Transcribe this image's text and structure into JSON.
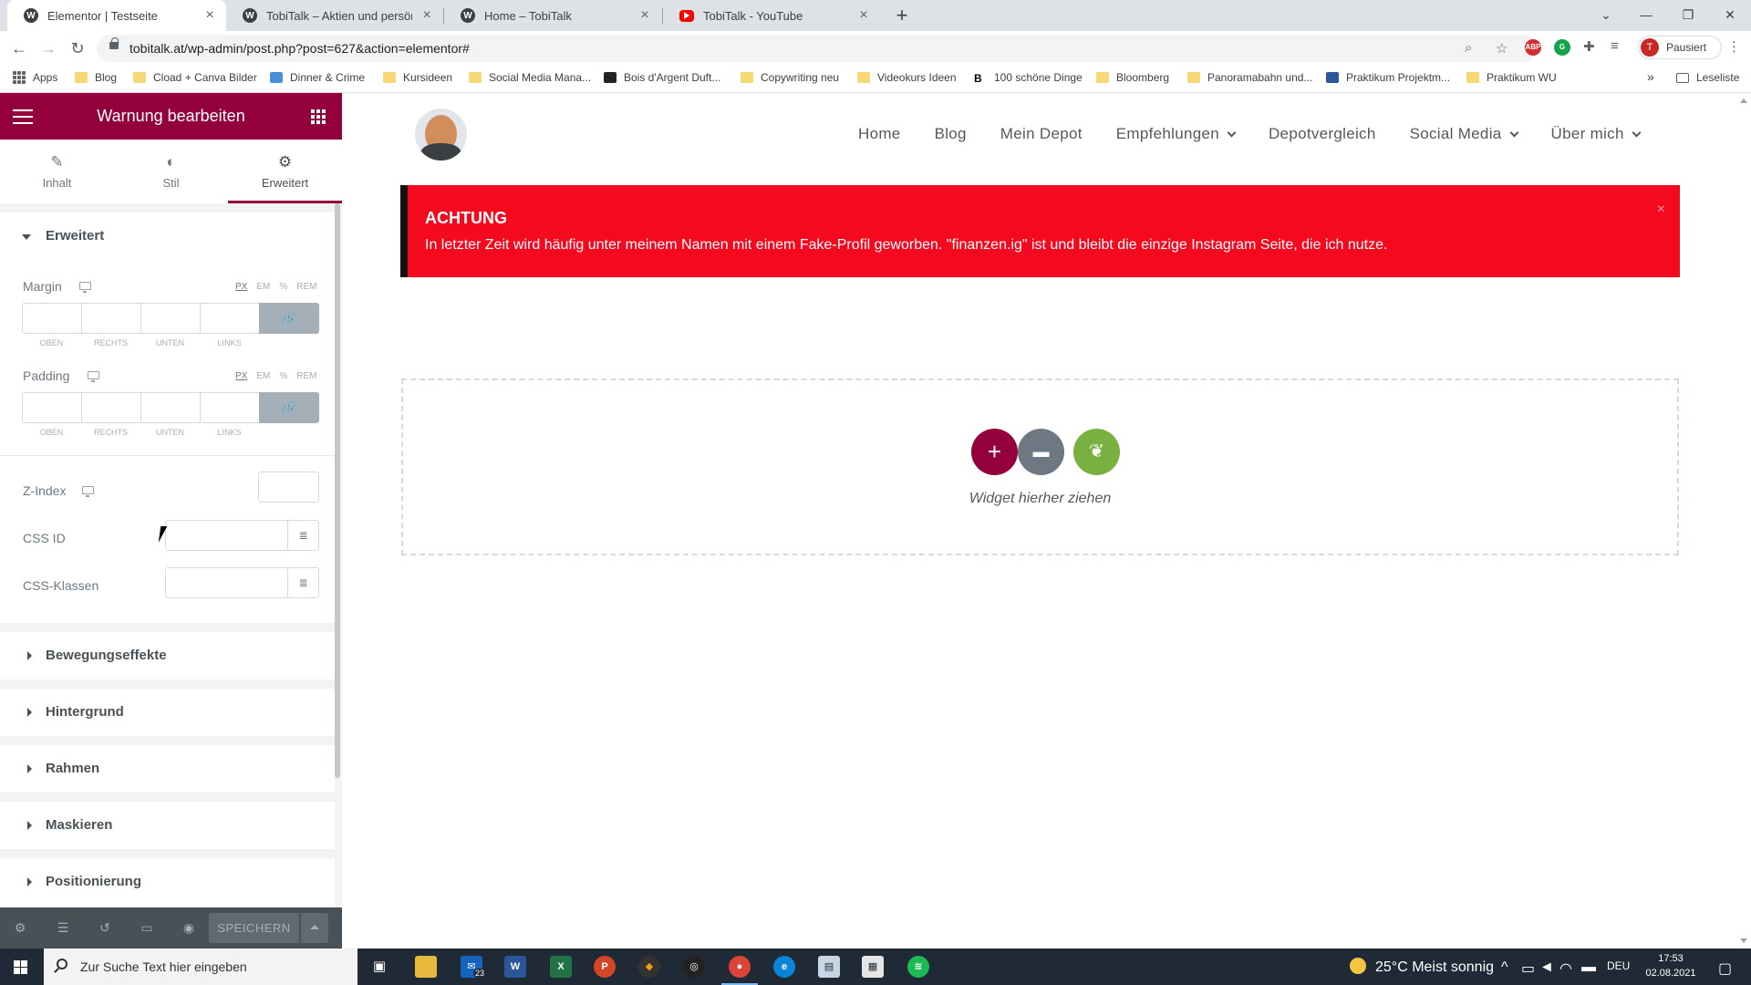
{
  "browser": {
    "tabs": [
      {
        "title": "Elementor | Testseite",
        "favicon": "wordpress-icon",
        "active": true
      },
      {
        "title": "TobiTalk – Aktien und persönliche",
        "favicon": "wordpress-icon",
        "active": false
      },
      {
        "title": "Home – TobiTalk",
        "favicon": "wordpress-icon",
        "active": false
      },
      {
        "title": "TobiTalk - YouTube",
        "favicon": "youtube-icon",
        "active": false
      }
    ],
    "new_tab": "+",
    "url": "tobitalk.at/wp-admin/post.php?post=627&action=elementor#",
    "profile_label": "Pausiert",
    "profile_initial": "T",
    "bookmarks": [
      {
        "label": "Apps",
        "icon": "apps-grid-icon"
      },
      {
        "label": "Blog",
        "icon": "folder-icon"
      },
      {
        "label": "Cload + Canva Bilder",
        "icon": "folder-icon"
      },
      {
        "label": "Dinner & Crime",
        "icon": "site-icon"
      },
      {
        "label": "Kursideen",
        "icon": "folder-icon"
      },
      {
        "label": "Social Media Mana...",
        "icon": "folder-icon"
      },
      {
        "label": "Bois d'Argent Duft...",
        "icon": "site-icon"
      },
      {
        "label": "Copywriting neu",
        "icon": "folder-icon"
      },
      {
        "label": "Videokurs Ideen",
        "icon": "folder-icon"
      },
      {
        "label": "100 schöne Dinge",
        "icon": "site-icon"
      },
      {
        "label": "Bloomberg",
        "icon": "folder-icon"
      },
      {
        "label": "Panoramabahn und...",
        "icon": "folder-icon"
      },
      {
        "label": "Praktikum Projektm...",
        "icon": "site-icon"
      },
      {
        "label": "Praktikum WU",
        "icon": "folder-icon"
      }
    ],
    "more_bookmarks": "»",
    "reading_list": "Leseliste"
  },
  "panel": {
    "header_title": "Warnung bearbeiten",
    "tabs": [
      {
        "label": "Inhalt",
        "icon": "pencil-icon"
      },
      {
        "label": "Stil",
        "icon": "contrast-icon"
      },
      {
        "label": "Erweitert",
        "icon": "gear-icon",
        "active": true
      }
    ],
    "section_title": "Erweitert",
    "margin": {
      "label": "Margin",
      "units": [
        "PX",
        "EM",
        "%",
        "REM"
      ],
      "selected_unit": "PX",
      "fields": [
        "OBEN",
        "RECHTS",
        "UNTEN",
        "LINKS"
      ],
      "values": [
        "",
        "",
        "",
        ""
      ]
    },
    "padding": {
      "label": "Padding",
      "units": [
        "PX",
        "EM",
        "%",
        "REM"
      ],
      "selected_unit": "PX",
      "fields": [
        "OBEN",
        "RECHTS",
        "UNTEN",
        "LINKS"
      ],
      "values": [
        "",
        "",
        "",
        ""
      ]
    },
    "z_index": {
      "label": "Z-Index",
      "value": ""
    },
    "css_id": {
      "label": "CSS ID",
      "value": ""
    },
    "css_classes": {
      "label": "CSS-Klassen",
      "value": ""
    },
    "collapsed_sections": [
      "Bewegungseffekte",
      "Hintergrund",
      "Rahmen",
      "Maskieren",
      "Positionierung"
    ],
    "save_label": "SPEICHERN"
  },
  "site": {
    "nav": [
      {
        "label": "Home",
        "dropdown": false
      },
      {
        "label": "Blog",
        "dropdown": false
      },
      {
        "label": "Mein Depot",
        "dropdown": false
      },
      {
        "label": "Empfehlungen",
        "dropdown": true
      },
      {
        "label": "Depotvergleich",
        "dropdown": false
      },
      {
        "label": "Social Media",
        "dropdown": true
      },
      {
        "label": "Über mich",
        "dropdown": true
      }
    ],
    "warning": {
      "title": "ACHTUNG",
      "message": "In letzter Zeit wird häufig unter meinem Namen mit einem Fake-Profil geworben. \"finanzen.ig\" ist und bleibt die einzige Instagram Seite, die ich nutze.",
      "close": "×",
      "background": "#f4091f"
    },
    "dropzone_text": "Widget hierher ziehen"
  },
  "taskbar": {
    "search_placeholder": "Zur Suche Text hier eingeben",
    "mail_badge": "23",
    "weather": "25°C  Meist sonnig",
    "language": "DEU",
    "time": "17:53",
    "date": "02.08.2021"
  },
  "colors": {
    "elementor_brand": "#93003c",
    "warning_red": "#f4091f",
    "add_button": "#93003c",
    "template_button": "#6d7882",
    "envato_button": "#78b13f"
  }
}
